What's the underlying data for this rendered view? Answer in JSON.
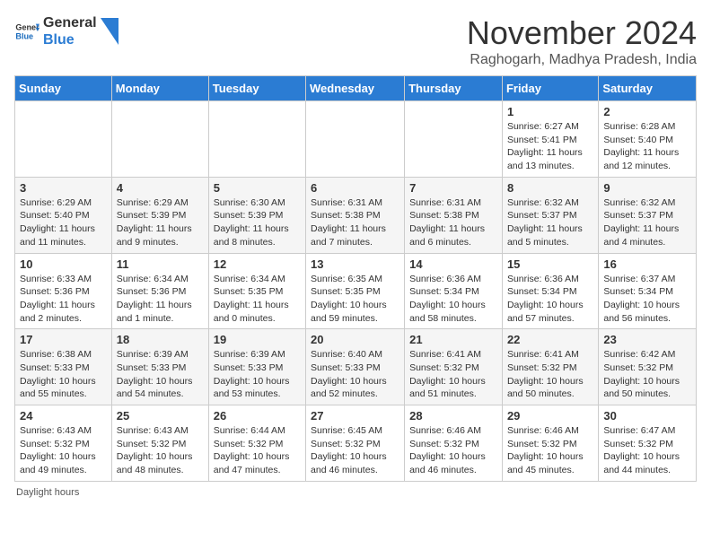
{
  "header": {
    "logo_line1": "General",
    "logo_line2": "Blue",
    "month_title": "November 2024",
    "location": "Raghogarh, Madhya Pradesh, India"
  },
  "days_of_week": [
    "Sunday",
    "Monday",
    "Tuesday",
    "Wednesday",
    "Thursday",
    "Friday",
    "Saturday"
  ],
  "weeks": [
    [
      {
        "day": "",
        "info": ""
      },
      {
        "day": "",
        "info": ""
      },
      {
        "day": "",
        "info": ""
      },
      {
        "day": "",
        "info": ""
      },
      {
        "day": "",
        "info": ""
      },
      {
        "day": "1",
        "info": "Sunrise: 6:27 AM\nSunset: 5:41 PM\nDaylight: 11 hours and 13 minutes."
      },
      {
        "day": "2",
        "info": "Sunrise: 6:28 AM\nSunset: 5:40 PM\nDaylight: 11 hours and 12 minutes."
      }
    ],
    [
      {
        "day": "3",
        "info": "Sunrise: 6:29 AM\nSunset: 5:40 PM\nDaylight: 11 hours and 11 minutes."
      },
      {
        "day": "4",
        "info": "Sunrise: 6:29 AM\nSunset: 5:39 PM\nDaylight: 11 hours and 9 minutes."
      },
      {
        "day": "5",
        "info": "Sunrise: 6:30 AM\nSunset: 5:39 PM\nDaylight: 11 hours and 8 minutes."
      },
      {
        "day": "6",
        "info": "Sunrise: 6:31 AM\nSunset: 5:38 PM\nDaylight: 11 hours and 7 minutes."
      },
      {
        "day": "7",
        "info": "Sunrise: 6:31 AM\nSunset: 5:38 PM\nDaylight: 11 hours and 6 minutes."
      },
      {
        "day": "8",
        "info": "Sunrise: 6:32 AM\nSunset: 5:37 PM\nDaylight: 11 hours and 5 minutes."
      },
      {
        "day": "9",
        "info": "Sunrise: 6:32 AM\nSunset: 5:37 PM\nDaylight: 11 hours and 4 minutes."
      }
    ],
    [
      {
        "day": "10",
        "info": "Sunrise: 6:33 AM\nSunset: 5:36 PM\nDaylight: 11 hours and 2 minutes."
      },
      {
        "day": "11",
        "info": "Sunrise: 6:34 AM\nSunset: 5:36 PM\nDaylight: 11 hours and 1 minute."
      },
      {
        "day": "12",
        "info": "Sunrise: 6:34 AM\nSunset: 5:35 PM\nDaylight: 11 hours and 0 minutes."
      },
      {
        "day": "13",
        "info": "Sunrise: 6:35 AM\nSunset: 5:35 PM\nDaylight: 10 hours and 59 minutes."
      },
      {
        "day": "14",
        "info": "Sunrise: 6:36 AM\nSunset: 5:34 PM\nDaylight: 10 hours and 58 minutes."
      },
      {
        "day": "15",
        "info": "Sunrise: 6:36 AM\nSunset: 5:34 PM\nDaylight: 10 hours and 57 minutes."
      },
      {
        "day": "16",
        "info": "Sunrise: 6:37 AM\nSunset: 5:34 PM\nDaylight: 10 hours and 56 minutes."
      }
    ],
    [
      {
        "day": "17",
        "info": "Sunrise: 6:38 AM\nSunset: 5:33 PM\nDaylight: 10 hours and 55 minutes."
      },
      {
        "day": "18",
        "info": "Sunrise: 6:39 AM\nSunset: 5:33 PM\nDaylight: 10 hours and 54 minutes."
      },
      {
        "day": "19",
        "info": "Sunrise: 6:39 AM\nSunset: 5:33 PM\nDaylight: 10 hours and 53 minutes."
      },
      {
        "day": "20",
        "info": "Sunrise: 6:40 AM\nSunset: 5:33 PM\nDaylight: 10 hours and 52 minutes."
      },
      {
        "day": "21",
        "info": "Sunrise: 6:41 AM\nSunset: 5:32 PM\nDaylight: 10 hours and 51 minutes."
      },
      {
        "day": "22",
        "info": "Sunrise: 6:41 AM\nSunset: 5:32 PM\nDaylight: 10 hours and 50 minutes."
      },
      {
        "day": "23",
        "info": "Sunrise: 6:42 AM\nSunset: 5:32 PM\nDaylight: 10 hours and 50 minutes."
      }
    ],
    [
      {
        "day": "24",
        "info": "Sunrise: 6:43 AM\nSunset: 5:32 PM\nDaylight: 10 hours and 49 minutes."
      },
      {
        "day": "25",
        "info": "Sunrise: 6:43 AM\nSunset: 5:32 PM\nDaylight: 10 hours and 48 minutes."
      },
      {
        "day": "26",
        "info": "Sunrise: 6:44 AM\nSunset: 5:32 PM\nDaylight: 10 hours and 47 minutes."
      },
      {
        "day": "27",
        "info": "Sunrise: 6:45 AM\nSunset: 5:32 PM\nDaylight: 10 hours and 46 minutes."
      },
      {
        "day": "28",
        "info": "Sunrise: 6:46 AM\nSunset: 5:32 PM\nDaylight: 10 hours and 46 minutes."
      },
      {
        "day": "29",
        "info": "Sunrise: 6:46 AM\nSunset: 5:32 PM\nDaylight: 10 hours and 45 minutes."
      },
      {
        "day": "30",
        "info": "Sunrise: 6:47 AM\nSunset: 5:32 PM\nDaylight: 10 hours and 44 minutes."
      }
    ]
  ],
  "footer": {
    "note": "Daylight hours"
  }
}
